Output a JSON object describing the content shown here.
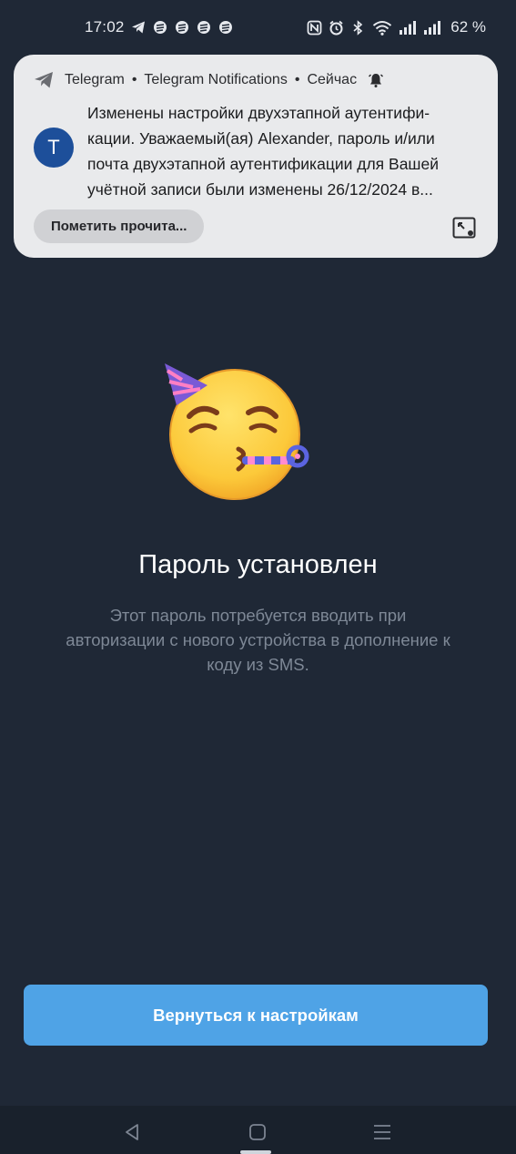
{
  "status_bar": {
    "time": "17:02",
    "battery": "62 %",
    "left_icons": [
      "telegram-icon",
      "app-icon",
      "app-icon",
      "app-icon",
      "app-icon"
    ],
    "right_icons": [
      "nfc-icon",
      "alarm-icon",
      "bluetooth-icon",
      "wifi-icon",
      "signal-icon",
      "signal-icon"
    ]
  },
  "notification": {
    "app_name": "Telegram",
    "channel": "Telegram Notifications",
    "time": "Сейчас",
    "avatar_letter": "T",
    "body_lines": [
      "Изменены настройки двухэтапной аутентифи-",
      "кации. Уважаемый(ая) Alexander, пароль и/или",
      "почта двухэтапной аутентификации для Вашей",
      "учётной записи были изменены 26/12/2024 в..."
    ],
    "action_label": "Пометить прочита...",
    "colors": {
      "avatar": "#1d4f9a",
      "background": "#e9eaec"
    }
  },
  "main": {
    "title": "Пароль установлен",
    "subtitle_lines": [
      "Этот пароль потребуется вводить при",
      "авторизации с нового устройства в дополнение к",
      "коду из SMS."
    ],
    "button_label": "Вернуться к настройкам",
    "colors": {
      "background": "#1f2836",
      "button": "#4fa3e6"
    }
  },
  "nav_bar": {
    "buttons": [
      "back-icon",
      "home-icon",
      "recents-icon"
    ]
  }
}
